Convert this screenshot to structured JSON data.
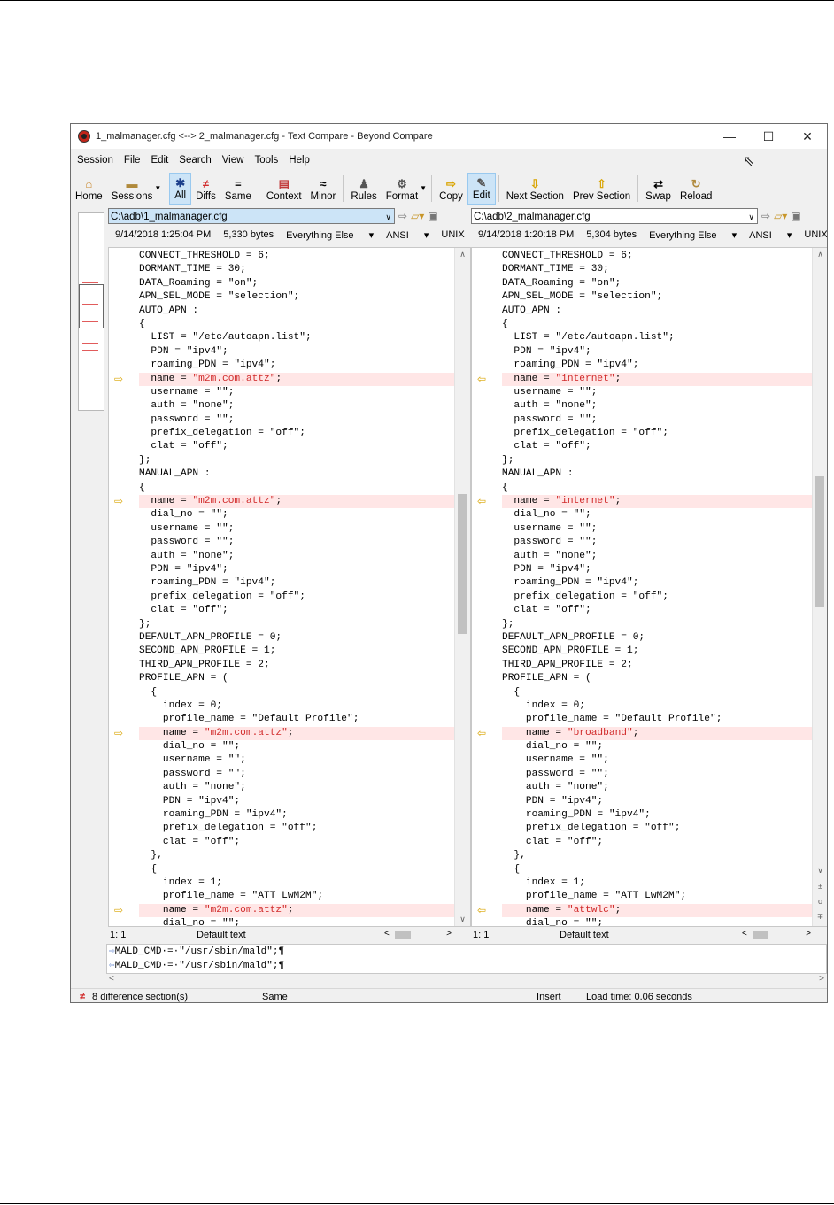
{
  "title": "1_malmanager.cfg <--> 2_malmanager.cfg - Text Compare - Beyond Compare",
  "window_controls": {
    "minimize": "—",
    "maximize": "☐",
    "close": "✕"
  },
  "menu": [
    "Session",
    "File",
    "Edit",
    "Search",
    "View",
    "Tools",
    "Help"
  ],
  "toolbar": [
    {
      "label": "Home",
      "icon": "home-icon",
      "glyph": "⌂"
    },
    {
      "label": "Sessions",
      "icon": "sessions-icon",
      "glyph": "▬"
    },
    {
      "label": "All",
      "icon": "all-icon",
      "glyph": "✱"
    },
    {
      "label": "Diffs",
      "icon": "diffs-icon",
      "glyph": "≠"
    },
    {
      "label": "Same",
      "icon": "same-icon",
      "glyph": "="
    },
    {
      "label": "Context",
      "icon": "context-icon",
      "glyph": "▤"
    },
    {
      "label": "Minor",
      "icon": "minor-icon",
      "glyph": "≈"
    },
    {
      "label": "Rules",
      "icon": "rules-icon",
      "glyph": "♟"
    },
    {
      "label": "Format",
      "icon": "format-icon",
      "glyph": "⚙"
    },
    {
      "label": "Copy",
      "icon": "copy-arrow-icon",
      "glyph": "⇨"
    },
    {
      "label": "Edit",
      "icon": "edit-icon",
      "glyph": "✎"
    },
    {
      "label": "Next Section",
      "icon": "next-section-icon",
      "glyph": "⇩"
    },
    {
      "label": "Prev Section",
      "icon": "prev-section-icon",
      "glyph": "⇧"
    },
    {
      "label": "Swap",
      "icon": "swap-icon",
      "glyph": "⇄"
    },
    {
      "label": "Reload",
      "icon": "reload-icon",
      "glyph": "↻"
    }
  ],
  "left": {
    "path": "C:\\adb\\1_malmanager.cfg",
    "date": "9/14/2018 1:25:04 PM",
    "size": "5,330 bytes",
    "filter": "Everything Else",
    "encoding": "ANSI",
    "line_endings": "UNIX",
    "cursor": "1: 1",
    "text_mode": "Default text",
    "lines": [
      {
        "t": "CONNECT_THRESHOLD = 6;"
      },
      {
        "t": "DORMANT_TIME = 30;"
      },
      {
        "t": "DATA_Roaming = \"on\";"
      },
      {
        "t": "APN_SEL_MODE = \"selection\";"
      },
      {
        "t": "AUTO_APN :"
      },
      {
        "t": "{"
      },
      {
        "t": "  LIST = \"/etc/autoapn.list\";"
      },
      {
        "t": "  PDN = \"ipv4\";"
      },
      {
        "t": "  roaming_PDN = \"ipv4\";"
      },
      {
        "t": "  name = ",
        "h": "\"m2m.com.attz\"",
        "e": ";",
        "d": true
      },
      {
        "t": "  username = \"\";"
      },
      {
        "t": "  auth = \"none\";"
      },
      {
        "t": "  password = \"\";"
      },
      {
        "t": "  prefix_delegation = \"off\";"
      },
      {
        "t": "  clat = \"off\";"
      },
      {
        "t": "};"
      },
      {
        "t": "MANUAL_APN :"
      },
      {
        "t": "{"
      },
      {
        "t": "  name = ",
        "h": "\"m2m.com.attz\"",
        "e": ";",
        "d": true
      },
      {
        "t": "  dial_no = \"\";"
      },
      {
        "t": "  username = \"\";"
      },
      {
        "t": "  password = \"\";"
      },
      {
        "t": "  auth = \"none\";"
      },
      {
        "t": "  PDN = \"ipv4\";"
      },
      {
        "t": "  roaming_PDN = \"ipv4\";"
      },
      {
        "t": "  prefix_delegation = \"off\";"
      },
      {
        "t": "  clat = \"off\";"
      },
      {
        "t": "};"
      },
      {
        "t": "DEFAULT_APN_PROFILE = 0;"
      },
      {
        "t": "SECOND_APN_PROFILE = 1;"
      },
      {
        "t": "THIRD_APN_PROFILE = 2;"
      },
      {
        "t": "PROFILE_APN = ("
      },
      {
        "t": "  {"
      },
      {
        "t": "    index = 0;"
      },
      {
        "t": "    profile_name = \"Default Profile\";"
      },
      {
        "t": "    name = ",
        "h": "\"m2m.com.attz\"",
        "e": ";",
        "d": true
      },
      {
        "t": "    dial_no = \"\";"
      },
      {
        "t": "    username = \"\";"
      },
      {
        "t": "    password = \"\";"
      },
      {
        "t": "    auth = \"none\";"
      },
      {
        "t": "    PDN = \"ipv4\";"
      },
      {
        "t": "    roaming_PDN = \"ipv4\";"
      },
      {
        "t": "    prefix_delegation = \"off\";"
      },
      {
        "t": "    clat = \"off\";"
      },
      {
        "t": "  },"
      },
      {
        "t": "  {"
      },
      {
        "t": "    index = 1;"
      },
      {
        "t": "    profile_name = \"ATT LwM2M\";"
      },
      {
        "t": "    name = ",
        "h": "\"m2m.com.attz\"",
        "e": ";",
        "d": true
      },
      {
        "t": "    dial_no = \"\";"
      }
    ]
  },
  "right": {
    "path": "C:\\adb\\2_malmanager.cfg",
    "date": "9/14/2018 1:20:18 PM",
    "size": "5,304 bytes",
    "filter": "Everything Else",
    "encoding": "ANSI",
    "line_endings": "UNIX",
    "cursor": "1: 1",
    "text_mode": "Default text",
    "lines": [
      {
        "t": "CONNECT_THRESHOLD = 6;"
      },
      {
        "t": "DORMANT_TIME = 30;"
      },
      {
        "t": "DATA_Roaming = \"on\";"
      },
      {
        "t": "APN_SEL_MODE = \"selection\";"
      },
      {
        "t": "AUTO_APN :"
      },
      {
        "t": "{"
      },
      {
        "t": "  LIST = \"/etc/autoapn.list\";"
      },
      {
        "t": "  PDN = \"ipv4\";"
      },
      {
        "t": "  roaming_PDN = \"ipv4\";"
      },
      {
        "t": "  name = ",
        "h": "\"internet\"",
        "e": ";",
        "d": true
      },
      {
        "t": "  username = \"\";"
      },
      {
        "t": "  auth = \"none\";"
      },
      {
        "t": "  password = \"\";"
      },
      {
        "t": "  prefix_delegation = \"off\";"
      },
      {
        "t": "  clat = \"off\";"
      },
      {
        "t": "};"
      },
      {
        "t": "MANUAL_APN :"
      },
      {
        "t": "{"
      },
      {
        "t": "  name = ",
        "h": "\"internet\"",
        "e": ";",
        "d": true
      },
      {
        "t": "  dial_no = \"\";"
      },
      {
        "t": "  username = \"\";"
      },
      {
        "t": "  password = \"\";"
      },
      {
        "t": "  auth = \"none\";"
      },
      {
        "t": "  PDN = \"ipv4\";"
      },
      {
        "t": "  roaming_PDN = \"ipv4\";"
      },
      {
        "t": "  prefix_delegation = \"off\";"
      },
      {
        "t": "  clat = \"off\";"
      },
      {
        "t": "};"
      },
      {
        "t": "DEFAULT_APN_PROFILE = 0;"
      },
      {
        "t": "SECOND_APN_PROFILE = 1;"
      },
      {
        "t": "THIRD_APN_PROFILE = 2;"
      },
      {
        "t": "PROFILE_APN = ("
      },
      {
        "t": "  {"
      },
      {
        "t": "    index = 0;"
      },
      {
        "t": "    profile_name = \"Default Profile\";"
      },
      {
        "t": "    name = ",
        "h": "\"broadband\"",
        "e": ";",
        "d": true
      },
      {
        "t": "    dial_no = \"\";"
      },
      {
        "t": "    username = \"\";"
      },
      {
        "t": "    password = \"\";"
      },
      {
        "t": "    auth = \"none\";"
      },
      {
        "t": "    PDN = \"ipv4\";"
      },
      {
        "t": "    roaming_PDN = \"ipv4\";"
      },
      {
        "t": "    prefix_delegation = \"off\";"
      },
      {
        "t": "    clat = \"off\";"
      },
      {
        "t": "  },"
      },
      {
        "t": "  {"
      },
      {
        "t": "    index = 1;"
      },
      {
        "t": "    profile_name = \"ATT LwM2M\";"
      },
      {
        "t": "    name = ",
        "h": "\"attwlc\"",
        "e": ";",
        "d": true
      },
      {
        "t": "    dial_no = \"\";"
      }
    ]
  },
  "bottom_lines": [
    {
      "arrow": "⇨",
      "text": "MALD_CMD·=·\"/usr/sbin/mald\";¶"
    },
    {
      "arrow": "⇦",
      "text": "MALD_CMD·=·\"/usr/sbin/mald\";¶"
    }
  ],
  "status": {
    "diff_count": "8 difference section(s)",
    "compare_state": "Same",
    "mode": "Insert",
    "load_time": "Load time: 0.06 seconds"
  },
  "colors": {
    "diff_bg": "#ffe6e6",
    "diff_text": "#d12b2b",
    "marker": "#d9a400",
    "accent": "#cce4f7"
  }
}
